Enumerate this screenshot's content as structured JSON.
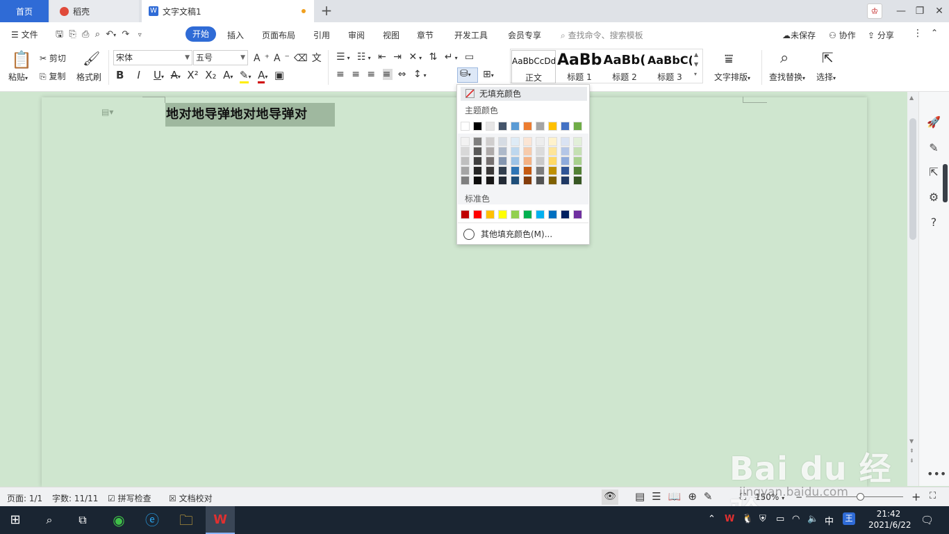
{
  "tabs": {
    "home": "首页",
    "daoke": "稻壳",
    "document": "文字文稿1"
  },
  "menu": {
    "file": "文件",
    "items": [
      "开始",
      "插入",
      "页面布局",
      "引用",
      "审阅",
      "视图",
      "章节",
      "开发工具",
      "会员专享"
    ],
    "search_placeholder": "查找命令、搜索模板",
    "unsaved": "未保存",
    "collab": "协作",
    "share": "分享"
  },
  "ribbon": {
    "paste": "粘贴",
    "cut": "剪切",
    "copy": "复制",
    "format_painter": "格式刷",
    "font_name": "宋体",
    "font_size": "五号",
    "styles": [
      {
        "preview": "AaBbCcDd",
        "name": "正文"
      },
      {
        "preview": "AaBb",
        "name": "标题 1"
      },
      {
        "preview": "AaBb(",
        "name": "标题 2"
      },
      {
        "preview": "AaBbC(",
        "name": "标题 3"
      }
    ],
    "text_layout": "文字排版",
    "find_replace": "查找替换",
    "select": "选择"
  },
  "document": {
    "text": "地对地导弹地对地导弹对"
  },
  "fill_menu": {
    "no_fill": "无填充颜色",
    "theme_colors_label": "主题颜色",
    "standard_colors_label": "标准色",
    "more_colors": "其他填充颜色(M)...",
    "theme_top_row": [
      "#ffffff",
      "#000000",
      "#e7e6e6",
      "#44546a",
      "#5b9bd5",
      "#ed7d31",
      "#a5a5a5",
      "#ffc000",
      "#4472c4",
      "#70ad47"
    ],
    "theme_shades": [
      [
        "#f2f2f2",
        "#7f7f7f",
        "#d0cece",
        "#d6dce4",
        "#deebf6",
        "#fbe5d5",
        "#ededed",
        "#fff2cc",
        "#dae3f3",
        "#e2efd9"
      ],
      [
        "#d8d8d8",
        "#595959",
        "#aeaaaa",
        "#adb9ca",
        "#bdd7ee",
        "#f7cbac",
        "#dbdbdb",
        "#fee599",
        "#b4c6e7",
        "#c5e0b3"
      ],
      [
        "#bfbfbf",
        "#3f3f3f",
        "#757070",
        "#8496b0",
        "#9dc3e6",
        "#f4b183",
        "#c9c9c9",
        "#ffd965",
        "#8eaadb",
        "#a8d08d"
      ],
      [
        "#a5a5a5",
        "#262626",
        "#3a3838",
        "#323f4f",
        "#2e75b5",
        "#c55a11",
        "#7b7b7b",
        "#bf9000",
        "#2f5496",
        "#538135"
      ],
      [
        "#7f7f7f",
        "#0c0c0c",
        "#171616",
        "#222a35",
        "#1e4e79",
        "#833c0b",
        "#525252",
        "#7f6000",
        "#1f3864",
        "#375623"
      ]
    ],
    "standard_colors": [
      "#c00000",
      "#ff0000",
      "#ffc000",
      "#ffff00",
      "#92d050",
      "#00b050",
      "#00b0f0",
      "#0070c0",
      "#002060",
      "#7030a0"
    ]
  },
  "status": {
    "page": "页面: 1/1",
    "word_count": "字数: 11/11",
    "spell_check": "拼写检查",
    "doc_proofread": "文档校对",
    "zoom": "150%"
  },
  "taskbar": {
    "time": "21:42",
    "date": "2021/6/22",
    "ime": "中"
  },
  "watermark": {
    "brand": "Bai du 经验",
    "url": "jingyan.baidu.com"
  }
}
